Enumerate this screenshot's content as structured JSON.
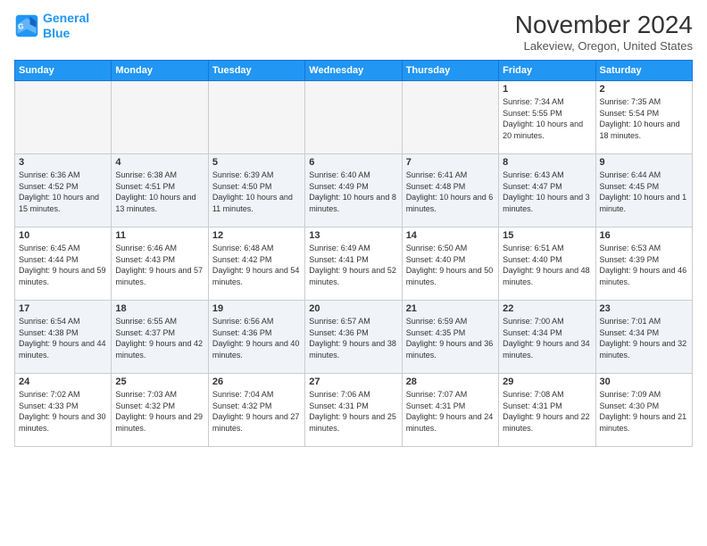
{
  "logo": {
    "line1": "General",
    "line2": "Blue"
  },
  "title": "November 2024",
  "location": "Lakeview, Oregon, United States",
  "days_of_week": [
    "Sunday",
    "Monday",
    "Tuesday",
    "Wednesday",
    "Thursday",
    "Friday",
    "Saturday"
  ],
  "weeks": [
    [
      {
        "day": "",
        "info": ""
      },
      {
        "day": "",
        "info": ""
      },
      {
        "day": "",
        "info": ""
      },
      {
        "day": "",
        "info": ""
      },
      {
        "day": "",
        "info": ""
      },
      {
        "day": "1",
        "info": "Sunrise: 7:34 AM\nSunset: 5:55 PM\nDaylight: 10 hours and 20 minutes."
      },
      {
        "day": "2",
        "info": "Sunrise: 7:35 AM\nSunset: 5:54 PM\nDaylight: 10 hours and 18 minutes."
      }
    ],
    [
      {
        "day": "3",
        "info": "Sunrise: 6:36 AM\nSunset: 4:52 PM\nDaylight: 10 hours and 15 minutes."
      },
      {
        "day": "4",
        "info": "Sunrise: 6:38 AM\nSunset: 4:51 PM\nDaylight: 10 hours and 13 minutes."
      },
      {
        "day": "5",
        "info": "Sunrise: 6:39 AM\nSunset: 4:50 PM\nDaylight: 10 hours and 11 minutes."
      },
      {
        "day": "6",
        "info": "Sunrise: 6:40 AM\nSunset: 4:49 PM\nDaylight: 10 hours and 8 minutes."
      },
      {
        "day": "7",
        "info": "Sunrise: 6:41 AM\nSunset: 4:48 PM\nDaylight: 10 hours and 6 minutes."
      },
      {
        "day": "8",
        "info": "Sunrise: 6:43 AM\nSunset: 4:47 PM\nDaylight: 10 hours and 3 minutes."
      },
      {
        "day": "9",
        "info": "Sunrise: 6:44 AM\nSunset: 4:45 PM\nDaylight: 10 hours and 1 minute."
      }
    ],
    [
      {
        "day": "10",
        "info": "Sunrise: 6:45 AM\nSunset: 4:44 PM\nDaylight: 9 hours and 59 minutes."
      },
      {
        "day": "11",
        "info": "Sunrise: 6:46 AM\nSunset: 4:43 PM\nDaylight: 9 hours and 57 minutes."
      },
      {
        "day": "12",
        "info": "Sunrise: 6:48 AM\nSunset: 4:42 PM\nDaylight: 9 hours and 54 minutes."
      },
      {
        "day": "13",
        "info": "Sunrise: 6:49 AM\nSunset: 4:41 PM\nDaylight: 9 hours and 52 minutes."
      },
      {
        "day": "14",
        "info": "Sunrise: 6:50 AM\nSunset: 4:40 PM\nDaylight: 9 hours and 50 minutes."
      },
      {
        "day": "15",
        "info": "Sunrise: 6:51 AM\nSunset: 4:40 PM\nDaylight: 9 hours and 48 minutes."
      },
      {
        "day": "16",
        "info": "Sunrise: 6:53 AM\nSunset: 4:39 PM\nDaylight: 9 hours and 46 minutes."
      }
    ],
    [
      {
        "day": "17",
        "info": "Sunrise: 6:54 AM\nSunset: 4:38 PM\nDaylight: 9 hours and 44 minutes."
      },
      {
        "day": "18",
        "info": "Sunrise: 6:55 AM\nSunset: 4:37 PM\nDaylight: 9 hours and 42 minutes."
      },
      {
        "day": "19",
        "info": "Sunrise: 6:56 AM\nSunset: 4:36 PM\nDaylight: 9 hours and 40 minutes."
      },
      {
        "day": "20",
        "info": "Sunrise: 6:57 AM\nSunset: 4:36 PM\nDaylight: 9 hours and 38 minutes."
      },
      {
        "day": "21",
        "info": "Sunrise: 6:59 AM\nSunset: 4:35 PM\nDaylight: 9 hours and 36 minutes."
      },
      {
        "day": "22",
        "info": "Sunrise: 7:00 AM\nSunset: 4:34 PM\nDaylight: 9 hours and 34 minutes."
      },
      {
        "day": "23",
        "info": "Sunrise: 7:01 AM\nSunset: 4:34 PM\nDaylight: 9 hours and 32 minutes."
      }
    ],
    [
      {
        "day": "24",
        "info": "Sunrise: 7:02 AM\nSunset: 4:33 PM\nDaylight: 9 hours and 30 minutes."
      },
      {
        "day": "25",
        "info": "Sunrise: 7:03 AM\nSunset: 4:32 PM\nDaylight: 9 hours and 29 minutes."
      },
      {
        "day": "26",
        "info": "Sunrise: 7:04 AM\nSunset: 4:32 PM\nDaylight: 9 hours and 27 minutes."
      },
      {
        "day": "27",
        "info": "Sunrise: 7:06 AM\nSunset: 4:31 PM\nDaylight: 9 hours and 25 minutes."
      },
      {
        "day": "28",
        "info": "Sunrise: 7:07 AM\nSunset: 4:31 PM\nDaylight: 9 hours and 24 minutes."
      },
      {
        "day": "29",
        "info": "Sunrise: 7:08 AM\nSunset: 4:31 PM\nDaylight: 9 hours and 22 minutes."
      },
      {
        "day": "30",
        "info": "Sunrise: 7:09 AM\nSunset: 4:30 PM\nDaylight: 9 hours and 21 minutes."
      }
    ]
  ]
}
